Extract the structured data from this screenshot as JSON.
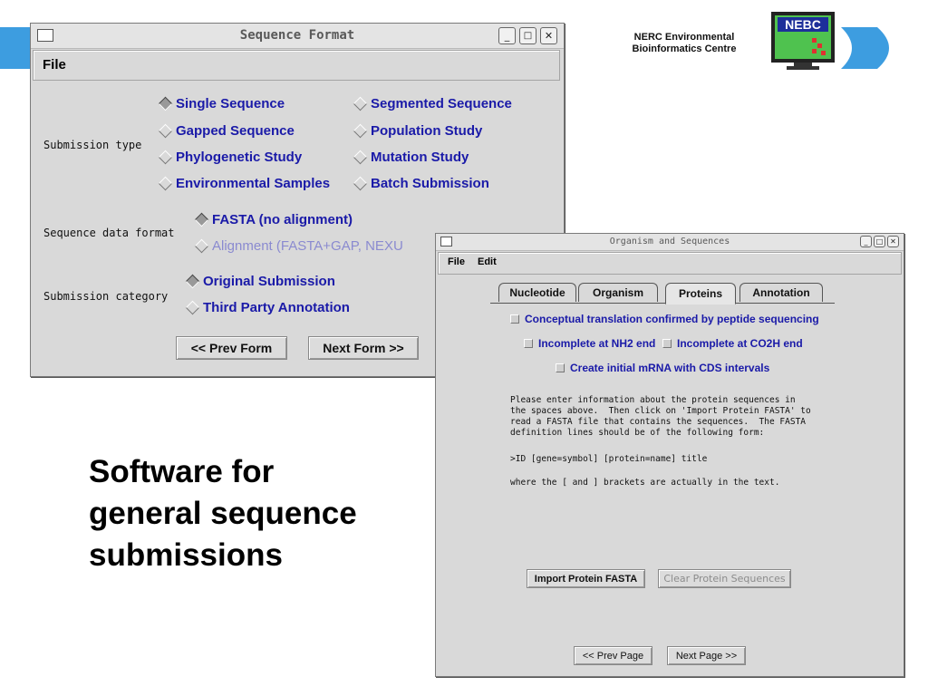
{
  "slide": {
    "org_name": "NERC Environmental\nBioinformatics Centre",
    "logo_text": "NEBC",
    "caption": "Software for general sequence submissions",
    "accent_color": "#3d9de0"
  },
  "seq_window": {
    "title": "Sequence Format",
    "menu": [
      "File"
    ],
    "submission_type": {
      "label": "Submission type",
      "options": [
        {
          "label": "Single Sequence",
          "selected": true
        },
        {
          "label": "Segmented Sequence",
          "selected": false
        },
        {
          "label": "Gapped Sequence",
          "selected": false
        },
        {
          "label": "Population Study",
          "selected": false
        },
        {
          "label": "Phylogenetic Study",
          "selected": false
        },
        {
          "label": "Mutation Study",
          "selected": false
        },
        {
          "label": "Environmental Samples",
          "selected": false
        },
        {
          "label": "Batch Submission",
          "selected": false
        }
      ]
    },
    "data_format": {
      "label": "Sequence data format",
      "options": [
        {
          "label": "FASTA (no alignment)",
          "selected": true
        },
        {
          "label": "Alignment (FASTA+GAP, NEXU",
          "selected": false,
          "disabled": true
        }
      ]
    },
    "category": {
      "label": "Submission category",
      "options": [
        {
          "label": "Original Submission",
          "selected": true
        },
        {
          "label": "Third Party Annotation",
          "selected": false
        }
      ]
    },
    "prev_button": "<< Prev Form",
    "next_button": "Next Form >>"
  },
  "org_window": {
    "title": "Organism and Sequences",
    "menu": [
      "File",
      "Edit"
    ],
    "tabs": [
      "Nucleotide",
      "Organism",
      "Proteins",
      "Annotation"
    ],
    "active_tab": "Proteins",
    "checkboxes": [
      "Conceptual translation confirmed by peptide sequencing",
      "Incomplete at NH2 end",
      "Incomplete at CO2H end",
      "Create initial mRNA with CDS intervals"
    ],
    "instructions": "Please enter information about the protein sequences in\nthe spaces above.  Then click on 'Import Protein FASTA' to\nread a FASTA file that contains the sequences.  The FASTA\ndefinition lines should be of the following form:",
    "example": ">ID [gene=symbol] [protein=name] title",
    "note": "where the [ and ] brackets are actually in the text.",
    "import_button": "Import Protein FASTA",
    "clear_button": "Clear Protein Sequences",
    "prev_button": "<< Prev Page",
    "next_button": "Next Page >>"
  }
}
